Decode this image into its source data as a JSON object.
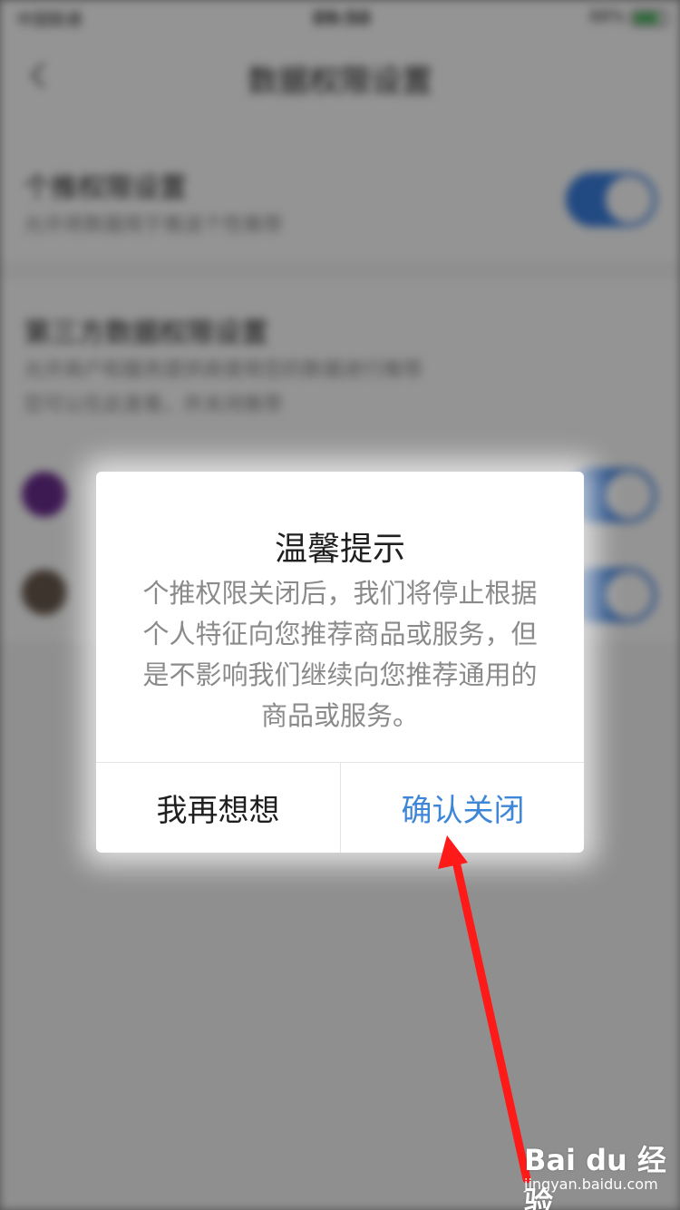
{
  "background": {
    "status_bar": {
      "carrier": "中国联通",
      "time": "09:50",
      "battery": "88%"
    },
    "nav": {
      "title": "数据权限设置"
    },
    "personal_setting": {
      "title": "个推权限设置",
      "subtitle": "允许将数据用于推送个性推荐",
      "enabled": true
    },
    "third_party": {
      "title": "第三方数据权限设置",
      "subtitle_line1": "允许商户和服务提供商使用您的数据进行推荐",
      "subtitle_line2": "您可以在此查看，并关闭推荐"
    },
    "colors": {
      "toggle_on": "#3a7fe0"
    }
  },
  "dialog": {
    "title": "温馨提示",
    "message_lines": [
      "个推权限关闭后，我们将停止根据",
      "个人特征向您推荐商品或服务，但",
      "是不影响我们继续向您推荐通用的",
      "商品或服务。"
    ],
    "cancel_label": "我再想想",
    "confirm_label": "确认关闭",
    "colors": {
      "confirm": "#3d86d8",
      "message": "#8a8a8a"
    }
  },
  "annotation": {
    "arrow_color": "#ff1a1a"
  },
  "watermark": {
    "brand": "Bai du 经验",
    "url": "jingyan.baidu.com"
  }
}
